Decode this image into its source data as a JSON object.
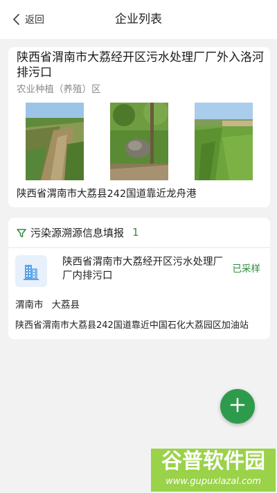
{
  "nav": {
    "back_label": "返回",
    "title": "企业列表"
  },
  "outfall": {
    "name": "陕西省渭南市大荔经开区污水处理厂厂外入洛河排污口",
    "category": "农业种植（养殖）区",
    "photos": [
      "outfall-photo",
      "outfall-photo",
      "outfall-photo"
    ],
    "address": "陕西省渭南市大荔县242国道靠近龙舟港"
  },
  "section": {
    "icon": "filter-icon",
    "label": "污染源溯源信息填报",
    "count": "1"
  },
  "enterprise": {
    "icon": "building-icon",
    "name": "陕西省渭南市大荔经开区污水处理厂厂内排污口",
    "status": "已采样",
    "city": "渭南市",
    "county": "大荔县",
    "address": "陕西省渭南市大荔县242国道靠近中国石化大荔园区加油站"
  },
  "fab": {
    "icon": "plus-icon"
  },
  "watermark": {
    "brand": "谷普软件园",
    "url": "www.gupuxlazal.com"
  },
  "colors": {
    "accent_green": "#2e9b4c",
    "status_green": "#2e8b3e",
    "icon_blue": "#5aa3e8",
    "icon_bg": "#e7f0fb"
  }
}
